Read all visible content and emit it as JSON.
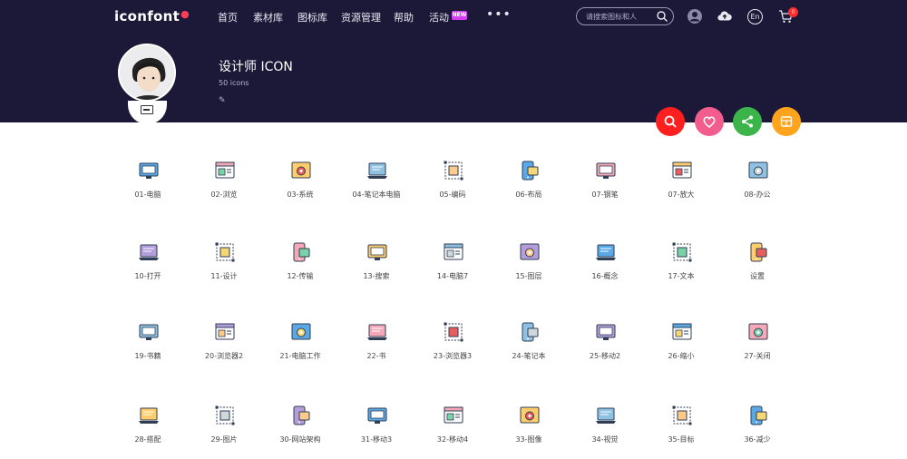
{
  "nav": {
    "logo": "iconfont",
    "items": [
      "首页",
      "素材库",
      "图标库",
      "资源管理",
      "帮助",
      "活动"
    ],
    "new_badge": "NEW",
    "more": "•••",
    "search_placeholder": "请搜索图标和人",
    "lang": "En",
    "cart_count": "0"
  },
  "profile": {
    "title": "设计师 ICON",
    "count": "50 icons",
    "edit": "✎"
  },
  "colors": {
    "header_bg": "#1b1838",
    "search_fab": "#ff1f1f",
    "favorite_fab": "#f25d8e",
    "share_fab": "#3bb54a",
    "download_fab": "#ffa41c"
  },
  "icons": [
    {
      "label": "01-电脑",
      "icon": "computer"
    },
    {
      "label": "02-浏览",
      "icon": "browser"
    },
    {
      "label": "03-系统",
      "icon": "system-gear"
    },
    {
      "label": "04-笔记本电脑",
      "icon": "laptop"
    },
    {
      "label": "05-编码",
      "icon": "code-windows"
    },
    {
      "label": "06-布局",
      "icon": "layout"
    },
    {
      "label": "07-钢笔",
      "icon": "pen-tool"
    },
    {
      "label": "07-放大",
      "icon": "enlarge"
    },
    {
      "label": "08-办公",
      "icon": "office"
    },
    {
      "label": "10-打开",
      "icon": "open"
    },
    {
      "label": "11-设计",
      "icon": "design"
    },
    {
      "label": "12-传输",
      "icon": "transfer"
    },
    {
      "label": "13-搜索",
      "icon": "search-doc"
    },
    {
      "label": "14-电脑7",
      "icon": "monitor"
    },
    {
      "label": "15-图层",
      "icon": "layers"
    },
    {
      "label": "16-概念",
      "icon": "concept-bulb"
    },
    {
      "label": "17-文本",
      "icon": "text"
    },
    {
      "label": "设置",
      "icon": "settings"
    },
    {
      "label": "19-书籍",
      "icon": "book"
    },
    {
      "label": "20-浏览器2",
      "icon": "browser-check"
    },
    {
      "label": "21-电脑工作",
      "icon": "phone-work"
    },
    {
      "label": "22-书",
      "icon": "notebook"
    },
    {
      "label": "23-浏览器3",
      "icon": "browser-folder"
    },
    {
      "label": "24-笔记本",
      "icon": "laptop-chart"
    },
    {
      "label": "25-移动2",
      "icon": "mobile-mail"
    },
    {
      "label": "26-缩小",
      "icon": "shrink"
    },
    {
      "label": "27-关闭",
      "icon": "close-window"
    },
    {
      "label": "28-搭配",
      "icon": "match"
    },
    {
      "label": "29-图片",
      "icon": "picture"
    },
    {
      "label": "30-网站架构",
      "icon": "sitemap"
    },
    {
      "label": "31-移动3",
      "icon": "mobile-grid"
    },
    {
      "label": "32-移动4",
      "icon": "mobile-list"
    },
    {
      "label": "33-图像",
      "icon": "image"
    },
    {
      "label": "34-视觉",
      "icon": "eye"
    },
    {
      "label": "35-目标",
      "icon": "target"
    },
    {
      "label": "36-减少",
      "icon": "reduce"
    }
  ]
}
